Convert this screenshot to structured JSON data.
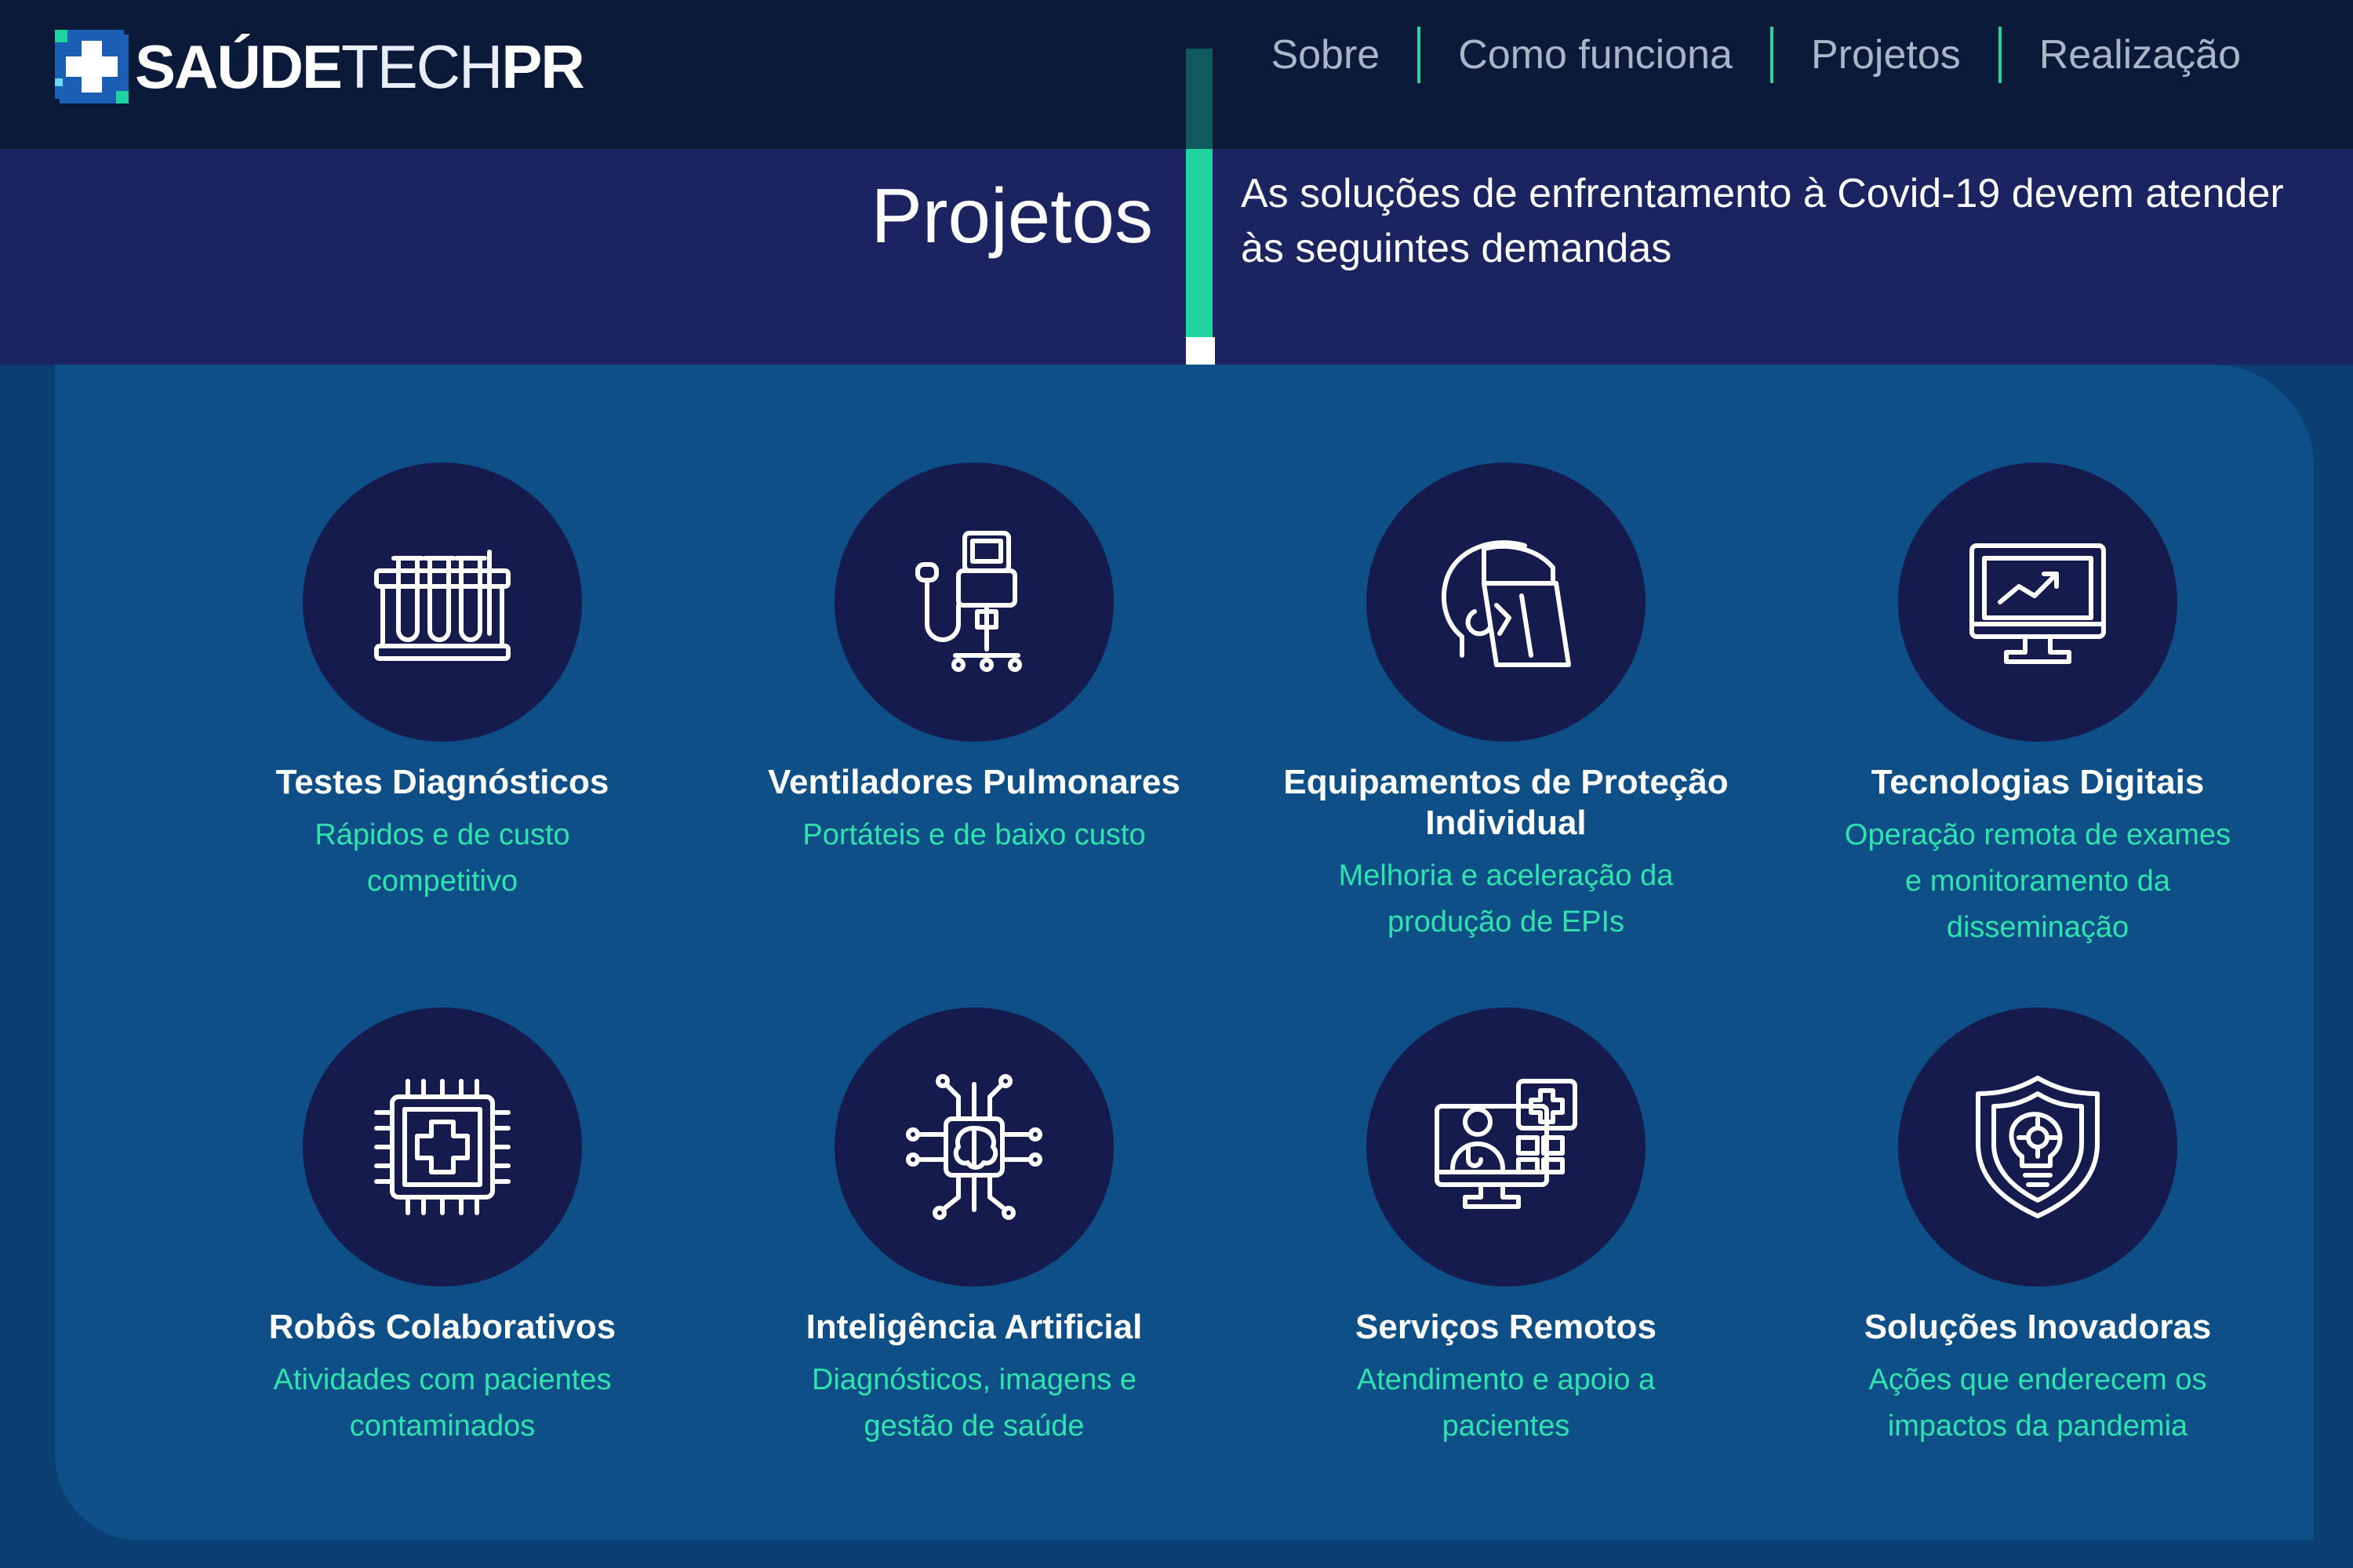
{
  "brand": {
    "name_bold": "SAÚDE",
    "name_thin": "TECH",
    "name_bold2": "PR"
  },
  "nav": {
    "items": [
      "Sobre",
      "Como funciona",
      "Projetos",
      "Realização"
    ]
  },
  "hero": {
    "title": "Projetos",
    "subtitle": "As soluções de enfrentamento à Covid-19 devem atender às seguintes demandas"
  },
  "cards": [
    {
      "title": "Testes Diagnósticos",
      "desc": "Rápidos e de custo competitivo",
      "icon": "test-tubes-icon"
    },
    {
      "title": "Ventiladores Pulmonares",
      "desc": "Portáteis e de baixo custo",
      "icon": "ventilator-icon"
    },
    {
      "title": "Equipamentos de Proteção Individual",
      "desc": "Melhoria e aceleração da produção de EPIs",
      "icon": "face-shield-icon"
    },
    {
      "title": "Tecnologias Digitais",
      "desc": "Operação remota de exames e monitoramento da disseminação",
      "icon": "monitor-chart-icon"
    },
    {
      "title": "Robôs Colaborativos",
      "desc": "Atividades com pacientes contaminados",
      "icon": "medical-chip-icon"
    },
    {
      "title": "Inteligência Artificial",
      "desc": "Diagnósticos, imagens e gestão de saúde",
      "icon": "brain-circuit-icon"
    },
    {
      "title": "Serviços Remotos",
      "desc": "Atendimento e apoio a pacientes",
      "icon": "telemedicine-icon"
    },
    {
      "title": "Soluções Inovadoras",
      "desc": "Ações que enderecem os impactos da pandemia",
      "icon": "shield-innovation-icon"
    }
  ],
  "colors": {
    "accent_green": "#1fd4a0",
    "header_bg": "#0c1a3a",
    "band_bg": "#1b2360",
    "panel_bg": "#0d4f86",
    "circle_bg": "#151b4d",
    "desc_text": "#2ee3ae"
  }
}
